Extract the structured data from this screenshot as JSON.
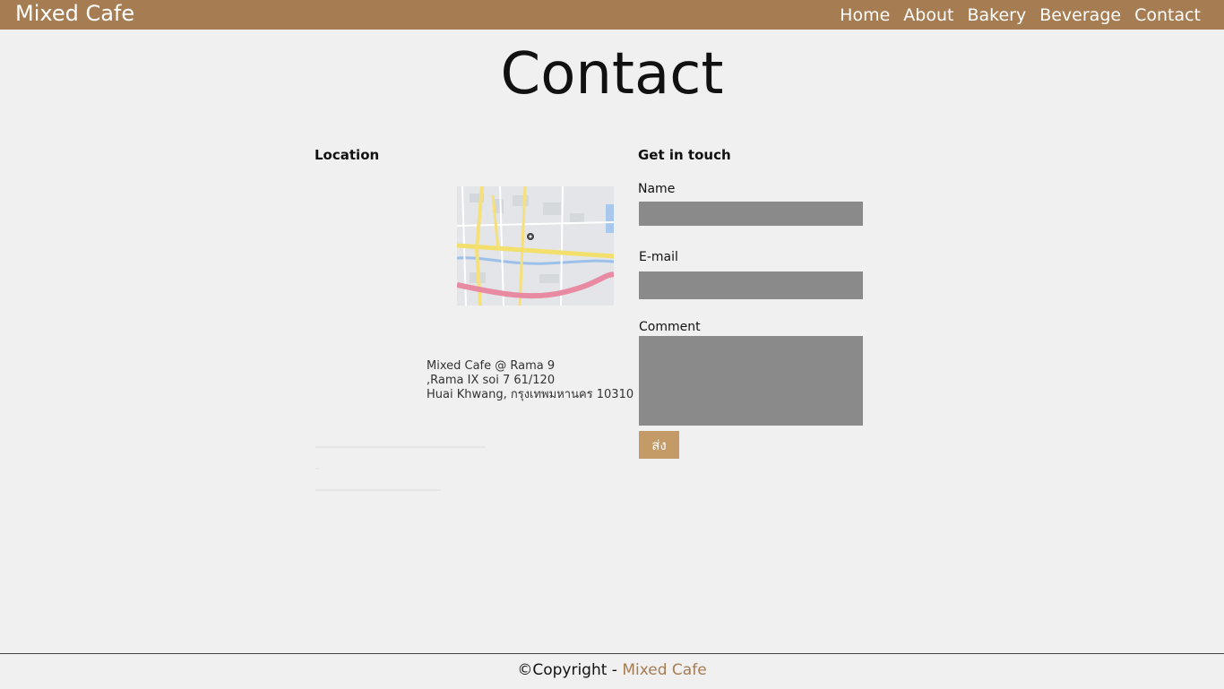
{
  "navbar": {
    "brand": "Mixed Cafe",
    "links": [
      "Home",
      "About",
      "Bakery",
      "Beverage",
      "Contact"
    ]
  },
  "page": {
    "title": "Contact"
  },
  "location": {
    "heading": "Location",
    "address_lines": [
      "Mixed Cafe @ Rama 9",
      ",Rama IX soi 7 61/120",
      "Huai Khwang, กรุงเทพมหานคร 10310"
    ]
  },
  "contact_form": {
    "heading": "Get in touch",
    "name_label": "Name",
    "email_label": "E-mail",
    "comment_label": "Comment",
    "name_value": "",
    "email_value": "",
    "comment_value": "",
    "submit_label": "ส่ง"
  },
  "footer": {
    "copyright": "©Copyright -",
    "brand": "Mixed Cafe"
  },
  "colors": {
    "navbar": "#a67c52",
    "button": "#c49a66",
    "field": "#8a8a8a"
  },
  "icons": [
    "map-pin-icon"
  ]
}
